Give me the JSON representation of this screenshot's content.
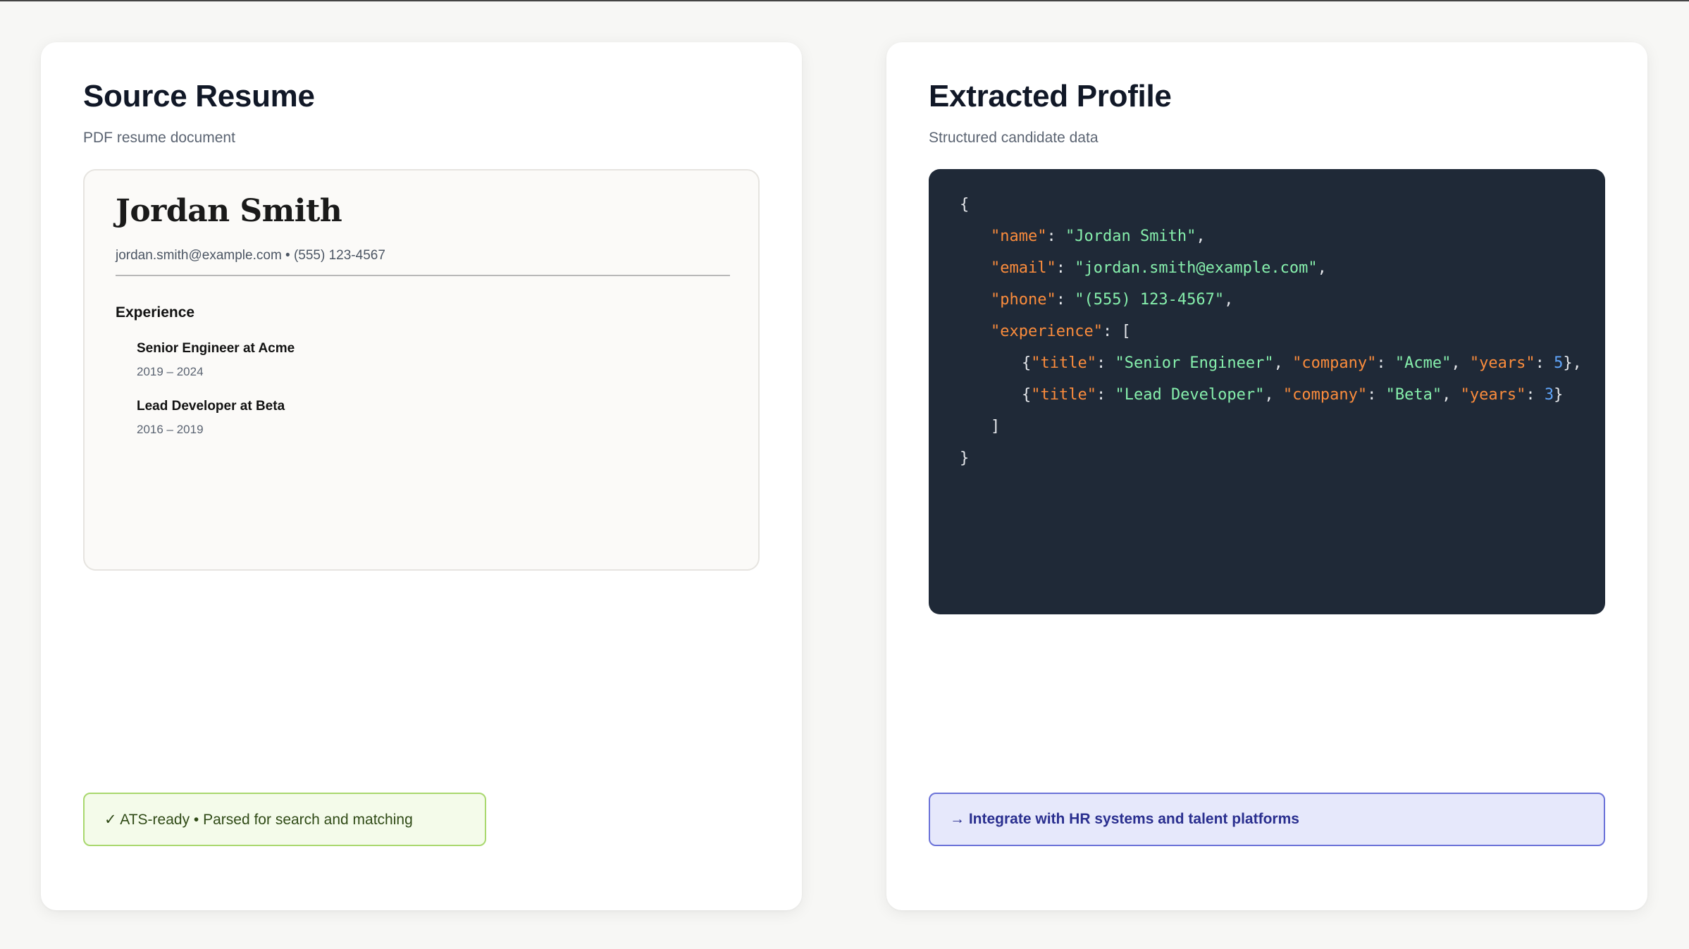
{
  "left_panel": {
    "title": "Source Resume",
    "subtitle": "PDF resume document",
    "resume": {
      "name": "Jordan Smith",
      "contact": "jordan.smith@example.com • (555) 123-4567",
      "section_title": "Experience",
      "jobs": [
        {
          "title": "Senior Engineer at Acme",
          "dates": "2019 – 2024"
        },
        {
          "title": "Lead Developer at Beta",
          "dates": "2016 – 2019"
        }
      ]
    },
    "badge": "✓ ATS-ready • Parsed for search and matching"
  },
  "right_panel": {
    "title": "Extracted Profile",
    "subtitle": "Structured candidate data",
    "json": {
      "open_brace": "{",
      "close_brace": "}",
      "name_key": "\"name\"",
      "name_value": "\"Jordan Smith\"",
      "email_key": "\"email\"",
      "email_value": "\"jordan.smith@example.com\"",
      "phone_key": "\"phone\"",
      "phone_value": "\"(555) 123-4567\"",
      "experience_key": "\"experience\"",
      "open_bracket": "[",
      "close_bracket": "]",
      "items": [
        {
          "title_key": "\"title\"",
          "title_value": "\"Senior Engineer\"",
          "company_key": "\"company\"",
          "company_value": "\"Acme\"",
          "years_key": "\"years\"",
          "years_value": "5"
        },
        {
          "title_key": "\"title\"",
          "title_value": "\"Lead Developer\"",
          "company_key": "\"company\"",
          "company_value": "\"Beta\"",
          "years_key": "\"years\"",
          "years_value": "3"
        }
      ]
    },
    "badge": "→ Integrate with HR systems and talent platforms"
  },
  "colors": {
    "json_key": "#fb8c3c",
    "json_string": "#86efac",
    "json_number": "#60a5fa",
    "code_background": "#1f2937",
    "ats_badge_border": "#a9d86e",
    "integrate_badge_border": "#6b72d8"
  }
}
